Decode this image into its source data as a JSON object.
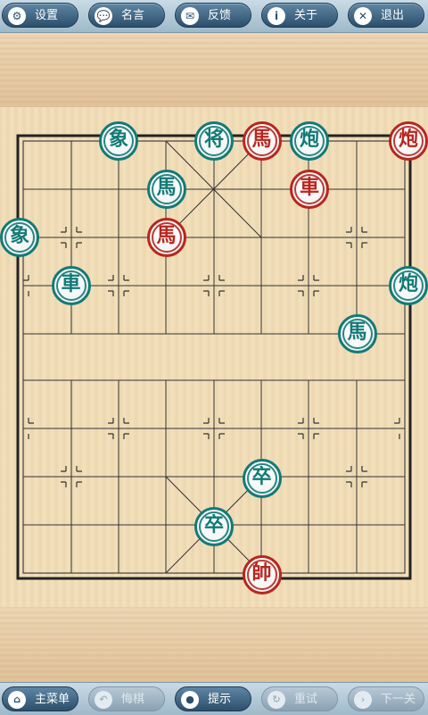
{
  "toolbar": {
    "settings": {
      "label": "设置",
      "icon": "gear-icon"
    },
    "quotes": {
      "label": "名言",
      "icon": "speech-bubble-icon"
    },
    "feedback": {
      "label": "反馈",
      "icon": "mail-icon"
    },
    "about": {
      "label": "关于",
      "icon": "info-icon"
    },
    "exit": {
      "label": "退出",
      "icon": "close-icon"
    }
  },
  "pieces": [
    {
      "name": "green-elephant-top",
      "text": "象",
      "side": "green",
      "col": 2,
      "row": 0
    },
    {
      "name": "green-general",
      "text": "将",
      "side": "green",
      "col": 4,
      "row": 0
    },
    {
      "name": "red-horse-top",
      "text": "馬",
      "side": "red",
      "col": 5,
      "row": 0
    },
    {
      "name": "green-cannon-top",
      "text": "炮",
      "side": "green",
      "col": 6,
      "row": 0
    },
    {
      "name": "red-cannon",
      "text": "炮",
      "side": "red",
      "col": 8.2,
      "row": 0
    },
    {
      "name": "green-horse-upper",
      "text": "馬",
      "side": "green",
      "col": 3,
      "row": 1
    },
    {
      "name": "red-chariot",
      "text": "車",
      "side": "red",
      "col": 6,
      "row": 1
    },
    {
      "name": "green-elephant-left",
      "text": "象",
      "side": "green",
      "col": -0.2,
      "row": 2
    },
    {
      "name": "red-horse-mid",
      "text": "馬",
      "side": "red",
      "col": 3,
      "row": 2
    },
    {
      "name": "green-chariot",
      "text": "車",
      "side": "green",
      "col": 1,
      "row": 3
    },
    {
      "name": "green-cannon-right",
      "text": "炮",
      "side": "green",
      "col": 8.2,
      "row": 3
    },
    {
      "name": "green-horse-right",
      "text": "馬",
      "side": "green",
      "col": 7,
      "row": 4
    },
    {
      "name": "green-soldier-upper",
      "text": "卒",
      "side": "green",
      "col": 5,
      "row": 7
    },
    {
      "name": "green-soldier-lower",
      "text": "卒",
      "side": "green",
      "col": 4,
      "row": 8
    },
    {
      "name": "red-marshal",
      "text": "帥",
      "side": "red",
      "col": 5,
      "row": 9
    }
  ],
  "bottombar": {
    "main_menu": {
      "label": "主菜单",
      "icon": "home-icon"
    },
    "undo": {
      "label": "悔棋",
      "icon": "undo-icon",
      "enabled": false
    },
    "hint": {
      "label": "提示",
      "icon": "lightbulb-icon"
    },
    "retry": {
      "label": "重试",
      "icon": "refresh-icon",
      "enabled": false
    },
    "next": {
      "label": "下一关",
      "icon": "next-icon",
      "enabled": false
    }
  }
}
